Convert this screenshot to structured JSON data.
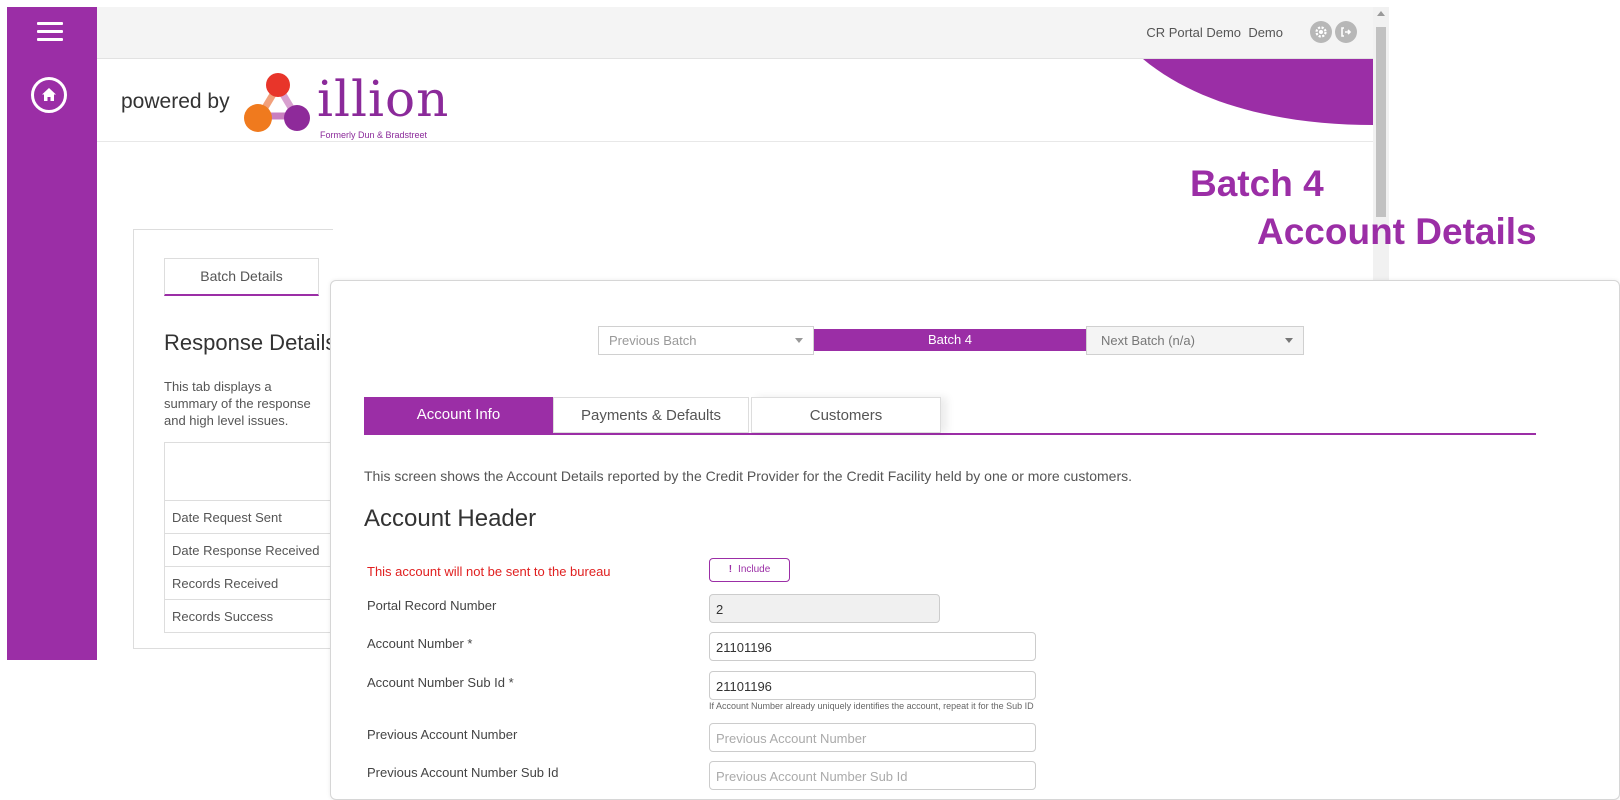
{
  "topbar": {
    "portal_name": "CR Portal Demo",
    "user_name": "Demo"
  },
  "brand": {
    "powered_by": "powered by",
    "name": "illion",
    "tagline": "Formerly Dun & Bradstreet"
  },
  "page_title": {
    "line1": "Batch 4",
    "line2": "Account Details"
  },
  "background": {
    "tab_label": "Batch Details",
    "response_title": "Response Details",
    "description": "This tab displays a summary of the response and high level issues.",
    "rows": [
      "Date Request Sent",
      "Date Response Received",
      "Records Received",
      "Records Success"
    ]
  },
  "batch_nav": {
    "previous": "Previous Batch",
    "current": "Batch 4",
    "next": "Next Batch (n/a)"
  },
  "tabs": {
    "account_info": "Account Info",
    "payments_defaults": "Payments & Defaults",
    "customers": "Customers"
  },
  "intro_text": "This screen shows the Account Details reported by the Credit Provider for the Credit Facility held by one or more customers.",
  "section_title": "Account Header",
  "warning": {
    "text": "This account will not be sent to the bureau",
    "include_icon": "!",
    "include_label": "Include"
  },
  "fields": {
    "portal_record_number": {
      "label": "Portal Record Number",
      "value": "2"
    },
    "account_number": {
      "label": "Account Number *",
      "value": "21101196"
    },
    "account_number_sub_id": {
      "label": "Account Number Sub Id *",
      "value": "21101196",
      "hint": "If Account Number already uniquely identifies the account, repeat it for the Sub ID"
    },
    "previous_account_number": {
      "label": "Previous Account Number",
      "placeholder": "Previous Account Number"
    },
    "previous_account_number_sub_id": {
      "label": "Previous Account Number Sub Id",
      "placeholder": "Previous Account Number Sub Id"
    }
  },
  "colors": {
    "brand_purple": "#9b2ea6",
    "warning_red": "#e02020"
  }
}
